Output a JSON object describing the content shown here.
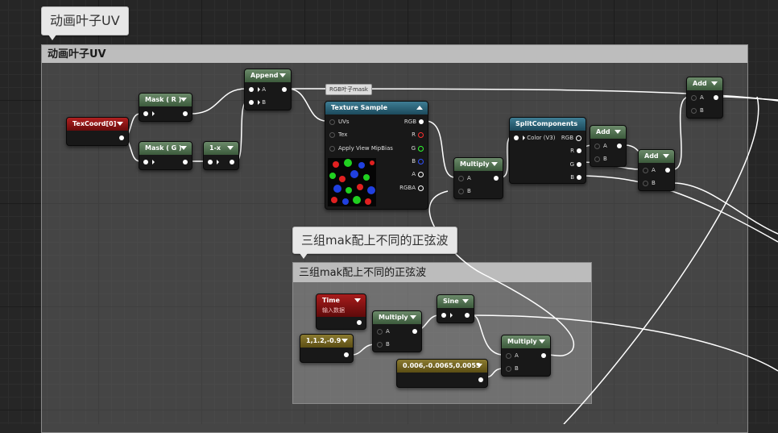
{
  "top_comment_bubble": "动画叶子UV",
  "main_comment_title": "动画叶子UV",
  "sub_comment_bubble": "三组mak配上不同的正弦波",
  "sub_comment_title": "三组mak配上不同的正弦波",
  "tooltip": "RGB叶子mask",
  "nodes": {
    "texcoord": {
      "title": "TexCoord[0]"
    },
    "mask_r": {
      "title": "Mask ( R )"
    },
    "mask_g": {
      "title": "Mask ( G )"
    },
    "one_minus": {
      "title": "1-x"
    },
    "append": {
      "title": "Append",
      "pin_a": "A",
      "pin_b": "B"
    },
    "texture_sample": {
      "title": "Texture Sample",
      "inputs": [
        "UVs",
        "Tex",
        "Apply View MipBias"
      ],
      "outputs": [
        "RGB",
        "R",
        "G",
        "B",
        "A",
        "RGBA"
      ]
    },
    "multiply1": {
      "title": "Multiply",
      "pin_a": "A",
      "pin_b": "B"
    },
    "split": {
      "title": "SplitComponents",
      "input": "Color (V3)",
      "outputs": [
        "RGB",
        "R",
        "G",
        "B"
      ]
    },
    "add1": {
      "title": "Add",
      "pin_a": "A",
      "pin_b": "B"
    },
    "add2": {
      "title": "Add",
      "pin_a": "A",
      "pin_b": "B"
    },
    "add3": {
      "title": "Add",
      "pin_a": "A",
      "pin_b": "B"
    },
    "time": {
      "title": "Time",
      "subtitle": "输入数据"
    },
    "multiply2": {
      "title": "Multiply",
      "pin_a": "A",
      "pin_b": "B"
    },
    "sine": {
      "title": "Sine"
    },
    "const1": {
      "title": "1,1.2,-0.9"
    },
    "multiply3": {
      "title": "Multiply",
      "pin_a": "A",
      "pin_b": "B"
    },
    "const2": {
      "title": "0.006,-0.0065,0.0055"
    }
  },
  "colors": {
    "background": "#262626",
    "comment_header": "#bdbdbd",
    "math_node_header": "#4c6b4b",
    "param_node_header": "#8b1414",
    "texture_node_header": "#2c627a",
    "constant_node_header": "#766624"
  }
}
